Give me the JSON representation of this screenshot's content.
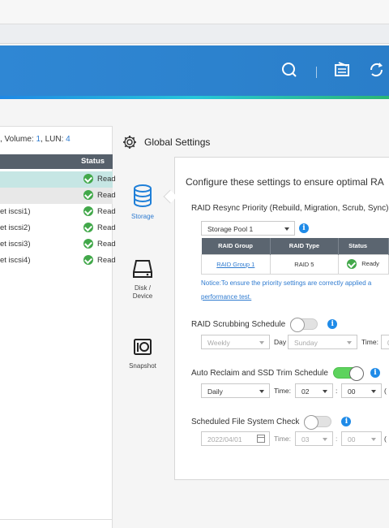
{
  "left_panel": {
    "info_prefix": ", Volume: ",
    "volume_num": "1",
    "lun_label": ", LUN: ",
    "lun_num": "4",
    "status_header": "Status",
    "rows": [
      {
        "name": "",
        "status": "Read",
        "highlight": "#c6e6e4"
      },
      {
        "name": "",
        "status": "Read",
        "highlight": "#e8e8e8"
      },
      {
        "name": "et iscsi1)",
        "status": "Read",
        "highlight": ""
      },
      {
        "name": "et iscsi2)",
        "status": "Read",
        "highlight": ""
      },
      {
        "name": "et iscsi3)",
        "status": "Read",
        "highlight": ""
      },
      {
        "name": "et iscsi4)",
        "status": "Read",
        "highlight": ""
      }
    ]
  },
  "window": {
    "title": "Global Settings",
    "sidebar": {
      "storage": "Storage",
      "disk_line1": "Disk /",
      "disk_line2": "Device",
      "snapshot": "Snapshot"
    },
    "intro": "Configure these settings to ensure optimal RA",
    "resync": {
      "title": "RAID Resync Priority (Rebuild, Migration, Scrub, Sync)",
      "pool_select": "Storage Pool 1",
      "table_headers": [
        "RAID Group",
        "RAID Type",
        "Status"
      ],
      "table_row": {
        "group": "RAID Group 1",
        "type": "RAID 5",
        "status": "Ready"
      },
      "notice": "Notice:To ensure the priority settings are correctly applied a",
      "notice_link": "performance test."
    },
    "scrubbing": {
      "title": "RAID Scrubbing Schedule",
      "enabled": false,
      "frequency": "Weekly",
      "day_label": "Day",
      "day": "Sunday",
      "time_label": "Time:",
      "time_value": "0"
    },
    "reclaim": {
      "title": "Auto Reclaim and SSD Trim Schedule",
      "enabled": true,
      "frequency": "Daily",
      "time_label": "Time:",
      "hour": "02",
      "minute": "00",
      "colon": ":",
      "paren": "("
    },
    "fscheck": {
      "title": "Scheduled File System Check",
      "enabled": false,
      "date": "2022/04/01",
      "time_label": "Time:",
      "hour": "03",
      "minute": "00",
      "colon": ":",
      "paren": "("
    }
  },
  "colors": {
    "header_blue": "#2f87d4",
    "accent_blue": "#2f7bd0",
    "ok_green": "#42a84a",
    "toggle_on": "#5dd35d"
  },
  "icons": [
    "search-icon",
    "notes-icon",
    "sync-icon",
    "gear-icon",
    "storage-icon",
    "disk-icon",
    "snapshot-icon",
    "info-icon",
    "calendar-icon",
    "check-circle-icon"
  ]
}
